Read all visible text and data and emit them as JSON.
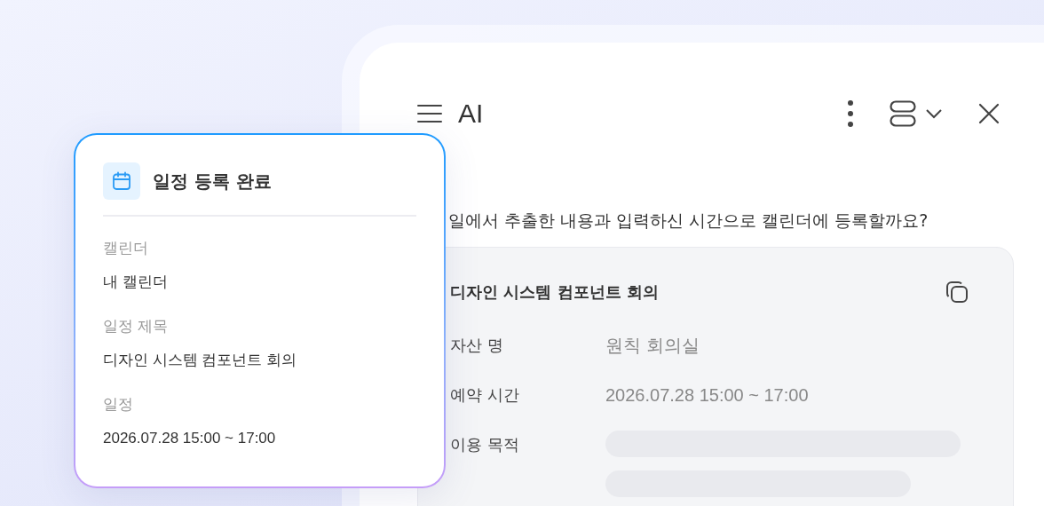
{
  "panel": {
    "title": "AI",
    "question": "일에서 추출한 내용과 입력하신 시간으로 캘린더에 등록할까요?",
    "info_card": {
      "title": "디자인 시스템 컴포넌트 회의",
      "rows": [
        {
          "label": "자산 명",
          "kind": "text",
          "value": "원칙 회의실"
        },
        {
          "label": "예약 시간",
          "kind": "text",
          "value": "2026.07.28 15:00 ~ 17:00"
        },
        {
          "label": "이용 목적",
          "kind": "loading"
        }
      ]
    }
  },
  "toast": {
    "title": "일정 등록 완료",
    "fields": [
      {
        "label": "캘린더",
        "value": "내 캘린더"
      },
      {
        "label": "일정 제목",
        "value": "디자인 시스템 컴포넌트 회의"
      },
      {
        "label": "일정",
        "value": "2026.07.28 15:00 ~ 17:00"
      }
    ]
  }
}
